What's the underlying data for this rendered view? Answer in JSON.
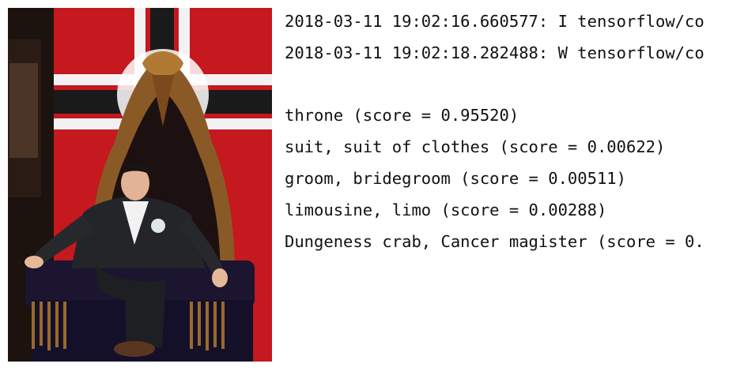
{
  "image": {
    "subject": "man-seated-on-ornate-throne-photo"
  },
  "terminal": {
    "log_lines": [
      "2018-03-11 19:02:16.660577: I tensorflow/co",
      "2018-03-11 19:02:18.282488: W tensorflow/co"
    ],
    "predictions": [
      "throne (score = 0.95520)",
      "suit, suit of clothes (score = 0.00622)",
      "groom, bridegroom (score = 0.00511)",
      "limousine, limo (score = 0.00288)",
      "Dungeness crab, Cancer magister (score = 0."
    ]
  }
}
